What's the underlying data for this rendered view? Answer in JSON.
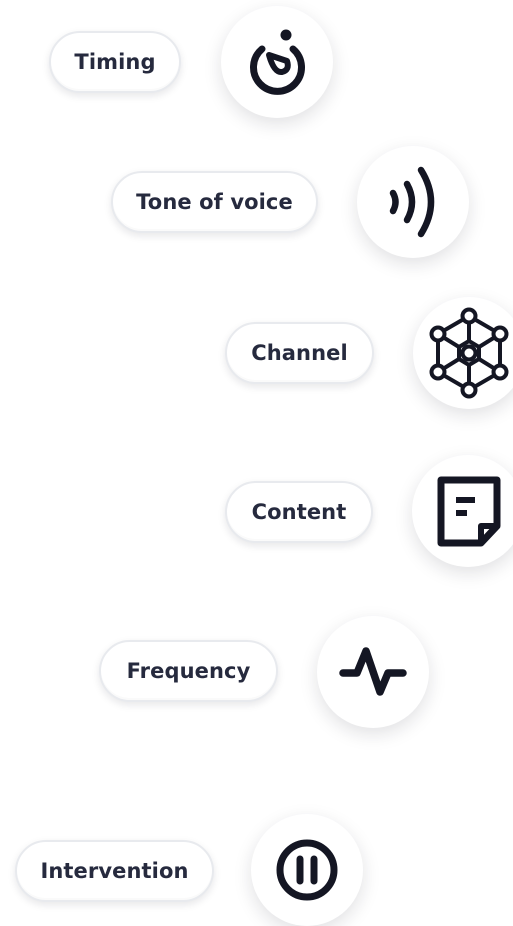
{
  "items": [
    {
      "label": "Timing",
      "icon": "timer-icon"
    },
    {
      "label": "Tone of voice",
      "icon": "sound-waves-icon"
    },
    {
      "label": "Channel",
      "icon": "network-icon"
    },
    {
      "label": "Content",
      "icon": "note-icon"
    },
    {
      "label": "Frequency",
      "icon": "pulse-icon"
    },
    {
      "label": "Intervention",
      "icon": "pause-icon"
    }
  ],
  "colors": {
    "icon": "#141623",
    "text": "#262a3e",
    "pill_border": "#e8eaee",
    "background": "#ffffff"
  }
}
